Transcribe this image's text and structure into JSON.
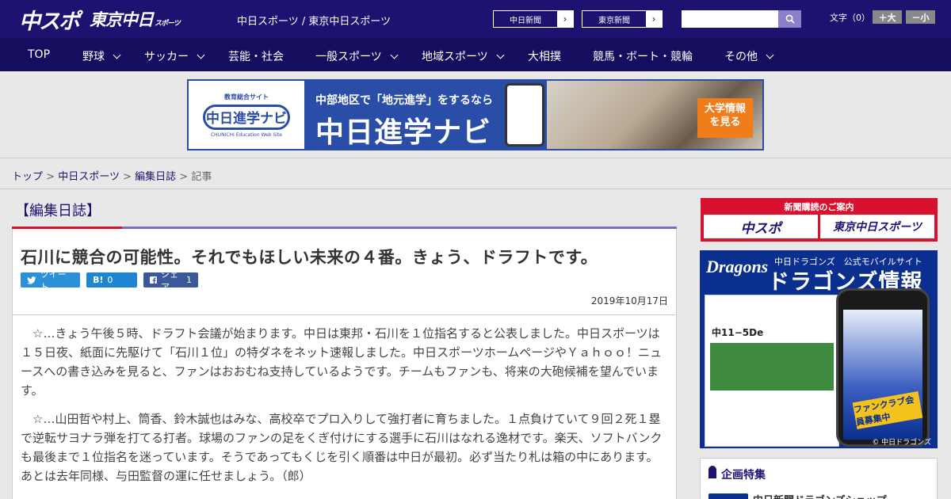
{
  "header": {
    "logo_main": "中スポ",
    "logo_sub": "東京中日",
    "logo_sub_small": "スポーツ",
    "site_names": "中日スポーツ / 東京中日スポーツ",
    "site_buttons": [
      {
        "label": "中日新聞",
        "arrow": "›"
      },
      {
        "label": "東京新聞",
        "arrow": "›"
      }
    ],
    "search_placeholder": "",
    "font_size_label": "文字（0）",
    "font_larger": "＋大",
    "font_smaller": "－小"
  },
  "nav": {
    "items": [
      {
        "label": "TOP"
      },
      {
        "label": "野球"
      },
      {
        "label": "サッカー"
      },
      {
        "label": "芸能・社会"
      },
      {
        "label": "一般スポーツ"
      },
      {
        "label": "地域スポーツ"
      },
      {
        "label": "大相撲"
      },
      {
        "label": "競馬・ボート・競輪"
      },
      {
        "label": "その他"
      }
    ]
  },
  "banner": {
    "small": "教育総合サイト",
    "logo": "中日進学ナビ",
    "en": "CHUNICHI Education Web Site",
    "line1": "中部地区で「地元進学」をするなら",
    "line2": "中日進学ナビ",
    "cta": "大学情報を見る"
  },
  "breadcrumb": {
    "items": [
      "トップ",
      "中日スポーツ",
      "編集日誌"
    ],
    "separator": ">",
    "current": "記事"
  },
  "article": {
    "category": "【編集日誌】",
    "headline": "石川に競合の可能性。それでもほしい未来の４番。きょう、ドラフトです。",
    "share": {
      "tweet": "ツイート",
      "hatena_label": "B!",
      "hatena_count": "0",
      "facebook": "シェア",
      "facebook_count": "1"
    },
    "date": "2019年10月17日",
    "paragraphs": [
      "☆…きょう午後５時、ドラフト会議が始まります。中日は東邦・石川を１位指名すると公表しました。中日スポーツは１５日夜、紙面に先駆けて「石川１位」の特ダネをネット速報しました。中日スポーツホームページやＹａｈｏｏ！ニュースへの書き込みを見ると、ファンはおおむね支持しているようです。チームもファンも、将来の大砲候補を望んでいます。",
      "☆…山田哲や村上、筒香、鈴木誠也はみな、高校卒でプロ入りして強打者に育ちました。１点負けていて９回２死１塁で逆転サヨナラ弾を打てる打者。球場のファンの足をくぎ付けにする選手に石川はなれる逸材です。楽天、ソフトバンクも最後まで１位指名を迷っています。そうであってもくじを引く順番は中日が最初。必ず当たり札は箱の中にあります。あとは去年同様、与田監督の運に任せましょう。（郎）"
    ]
  },
  "sidebar": {
    "subscribe_title": "新聞購読のご案内",
    "subscribe_a": "中スポ",
    "subscribe_b": "東京中日スポーツ",
    "dragons_logo": "Dragons",
    "dragons_sub": "中日ドラゴンズ　公式モバイルサイト",
    "dragons_title": "ドラゴンズ情報",
    "dragons_score": "中11−5De",
    "dragons_tag": "ファンクラブ会員募集中",
    "dragons_copy": "© 中日ドラゴンズ",
    "feature_title": "企画特集",
    "feature_item": "中日新聞ドラゴンズショップ"
  }
}
